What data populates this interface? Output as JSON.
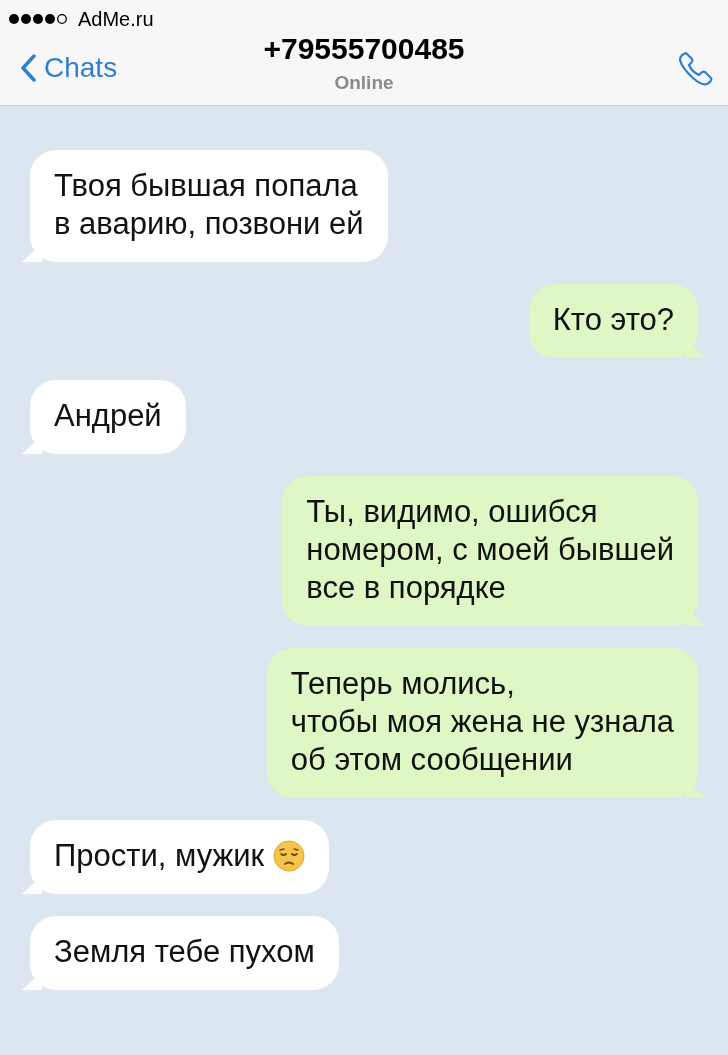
{
  "status_bar": {
    "carrier": "AdMe.ru"
  },
  "nav_bar": {
    "back_label": "Chats",
    "title": "+79555700485",
    "subtitle": "Online"
  },
  "messages": [
    {
      "kind": "incoming",
      "text": "Твоя бывшая попала\nв аварию, позвони ей",
      "has_emoji": false
    },
    {
      "kind": "outgoing",
      "text": "Кто это?",
      "has_emoji": false
    },
    {
      "kind": "incoming",
      "text": "Андрей",
      "has_emoji": false
    },
    {
      "kind": "outgoing",
      "text": "Ты, видимо, ошибся\nномером, с моей бывшей\nвсе в порядке",
      "has_emoji": false
    },
    {
      "kind": "outgoing",
      "text": "Теперь молись,\nчтобы моя жена не узнала\nоб этом сообщении",
      "has_emoji": false
    },
    {
      "kind": "incoming",
      "text": "Прости, мужик",
      "has_emoji": true
    },
    {
      "kind": "incoming",
      "text": "Земля тебе пухом",
      "has_emoji": false
    }
  ]
}
